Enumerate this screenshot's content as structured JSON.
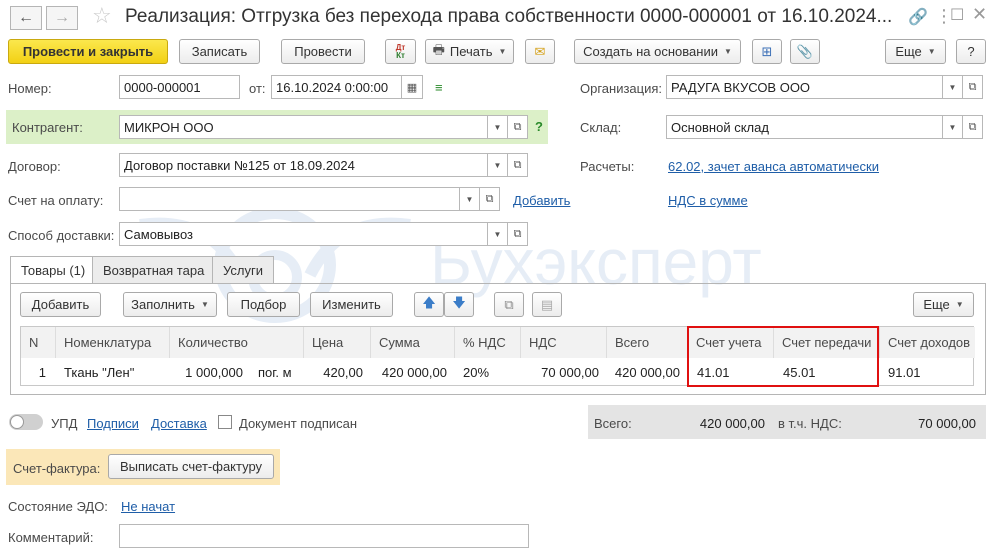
{
  "window": {
    "title": "Реализация: Отгрузка без перехода права собственности 0000-000001 от 16.10.2024..."
  },
  "toolbar": {
    "post_close": "Провести и закрыть",
    "save": "Записать",
    "post": "Провести",
    "dt_kt": "Дт\nКт",
    "print": "Печать",
    "create_based": "Создать на основании",
    "more": "Еще",
    "help": "?"
  },
  "header": {
    "number_label": "Номер:",
    "number_value": "0000-000001",
    "date_label": "от:",
    "date_value": "16.10.2024  0:00:00",
    "org_label": "Организация:",
    "org_value": "РАДУГА ВКУСОВ ООО",
    "counterparty_label": "Контрагент:",
    "counterparty_value": "МИКРОН ООО",
    "counterparty_help": "?",
    "warehouse_label": "Склад:",
    "warehouse_value": "Основной склад",
    "contract_label": "Договор:",
    "contract_value": "Договор поставки №125 от 18.09.2024",
    "settlements_label": "Расчеты:",
    "settlements_link": "62.02, зачет аванса автоматически",
    "invoice_label": "Счет на оплату:",
    "invoice_value": "",
    "invoice_add": "Добавить",
    "vat_link": "НДС в сумме",
    "delivery_label": "Способ доставки:",
    "delivery_value": "Самовывоз"
  },
  "watermark": "Бухэксперт",
  "tabs": [
    {
      "label": "Товары (1)"
    },
    {
      "label": "Возвратная тара"
    },
    {
      "label": "Услуги"
    }
  ],
  "table_toolbar": {
    "add": "Добавить",
    "fill": "Заполнить",
    "pick": "Подбор",
    "edit": "Изменить",
    "more": "Еще"
  },
  "table": {
    "columns": [
      "N",
      "Номенклатура",
      "Количество",
      "Цена",
      "Сумма",
      "% НДС",
      "НДС",
      "Всего",
      "Счет учета",
      "Счет передачи",
      "Счет доходов"
    ],
    "rows": [
      {
        "n": "1",
        "item": "Ткань \"Лен\"",
        "qty": "1 000,000",
        "unit": "пог. м",
        "price": "420,00",
        "sum": "420 000,00",
        "vat_rate": "20%",
        "vat": "70 000,00",
        "total": "420 000,00",
        "account": "41.01",
        "transfer_account": "45.01",
        "income_account": "91.01"
      }
    ]
  },
  "footer": {
    "upd_label": "УПД",
    "signatures_link": "Подписи",
    "delivery_link": "Доставка",
    "signed_label": "Документ подписан",
    "total_label": "Всего:",
    "total_value": "420 000,00",
    "vat_label": "в т.ч. НДС:",
    "vat_value": "70 000,00",
    "invoice_label": "Счет-фактура:",
    "invoice_button": "Выписать счет-фактуру",
    "edo_label": "Состояние ЭДО:",
    "edo_link": "Не начат",
    "comment_label": "Комментарий:",
    "comment_value": ""
  },
  "colors": {
    "primary_button": "#f2d014",
    "counterparty_highlight": "#dcf0c8",
    "invoice_highlight": "#fbe7b8",
    "link": "#1f5ea8",
    "highlight_border": "#e01010"
  }
}
